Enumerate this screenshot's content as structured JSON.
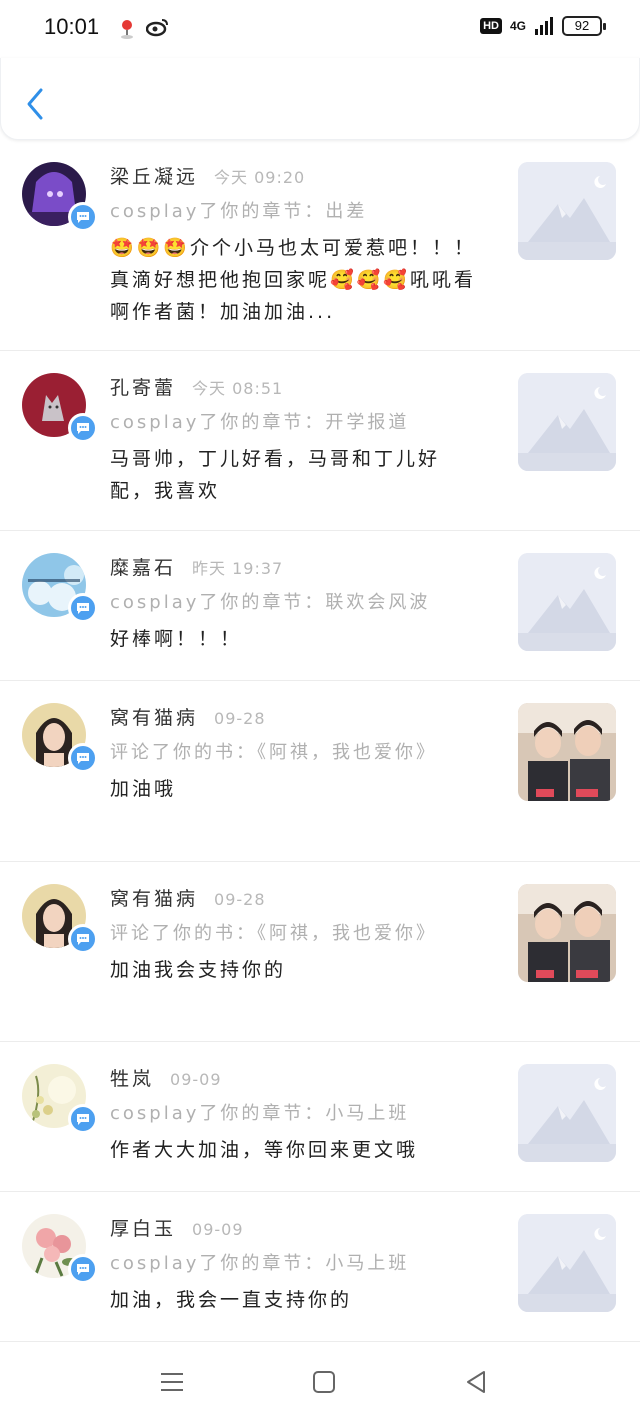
{
  "status_bar": {
    "time": "10:01",
    "battery": "92",
    "network": "4G",
    "hd": "HD"
  },
  "colors": {
    "accent": "#4da0f0",
    "back": "#2f8fe8"
  },
  "items": [
    {
      "name": "梁丘凝远",
      "time": "今天 09:20",
      "action": "cosplay了你的章节：出差",
      "comment": "🤩🤩🤩介个小马也太可爱惹吧！！！真滴好想把他抱回家呢🥰🥰🥰吼吼看啊作者菌！加油加油...",
      "thumb": "placeholder",
      "avatar": "anime-girl-purple"
    },
    {
      "name": "孔寄蕾",
      "time": "今天 08:51",
      "action": "cosplay了你的章节：开学报道",
      "comment": "马哥帅，丁儿好看，马哥和丁儿好配，我喜欢",
      "thumb": "placeholder",
      "avatar": "red-cat"
    },
    {
      "name": "糜嘉石",
      "time": "昨天 19:37",
      "action": "cosplay了你的章节：联欢会风波",
      "comment": "好棒啊！！！",
      "thumb": "placeholder",
      "avatar": "blue-sky"
    },
    {
      "name": "窝有猫病",
      "time": "09-28",
      "action": "评论了你的书：《阿祺，我也爱你》",
      "comment": "加油哦",
      "thumb": "photo",
      "avatar": "girl-portrait"
    },
    {
      "name": "窝有猫病",
      "time": "09-28",
      "action": "评论了你的书：《阿祺，我也爱你》",
      "comment": "加油我会支持你的",
      "thumb": "photo",
      "avatar": "girl-portrait"
    },
    {
      "name": "牲岚",
      "time": "09-09",
      "action": "cosplay了你的章节：小马上班",
      "comment": "作者大大加油，等你回来更文哦",
      "thumb": "placeholder",
      "avatar": "flowers-light"
    },
    {
      "name": "厚白玉",
      "time": "09-09",
      "action": "cosplay了你的章节：小马上班",
      "comment": "加油，我会一直支持你的",
      "thumb": "placeholder",
      "avatar": "peony-flowers"
    }
  ]
}
